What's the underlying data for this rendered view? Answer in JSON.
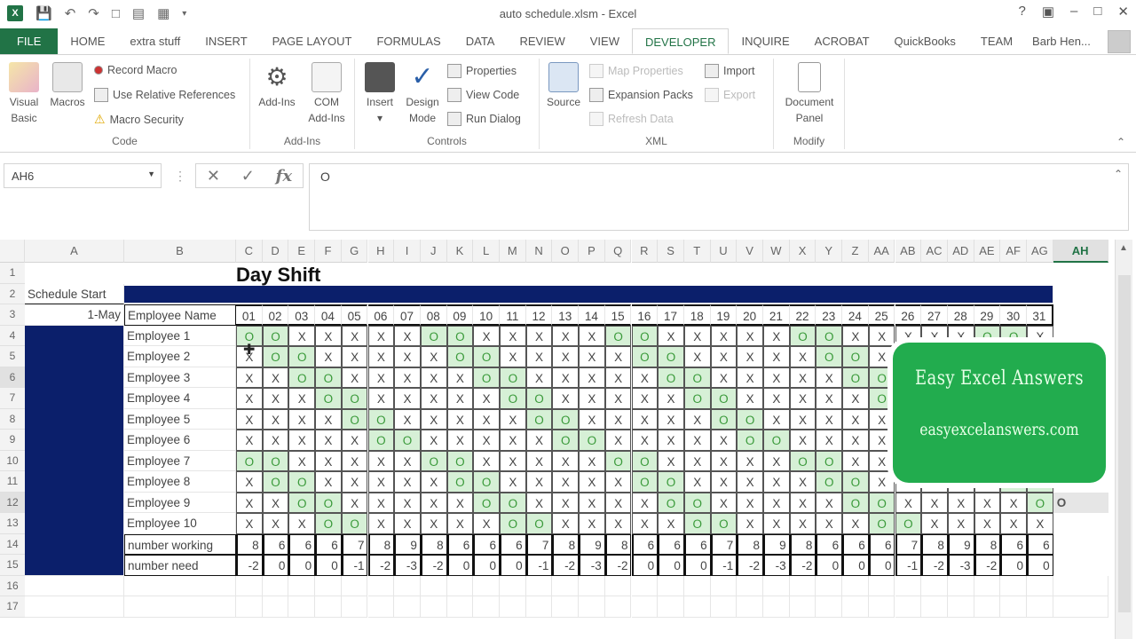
{
  "window": {
    "title": "auto schedule.xlsm - Excel",
    "controls": [
      "?",
      "▣",
      "–",
      "□",
      "✕"
    ]
  },
  "qat": {
    "icons": [
      "excel-logo-icon",
      "save-icon",
      "undo-icon",
      "redo-icon",
      "new-file-icon",
      "form-icon",
      "camera-icon",
      "customize-icon"
    ]
  },
  "tabs": [
    {
      "label": "FILE"
    },
    {
      "label": "HOME"
    },
    {
      "label": "extra stuff"
    },
    {
      "label": "INSERT"
    },
    {
      "label": "PAGE LAYOUT"
    },
    {
      "label": "FORMULAS"
    },
    {
      "label": "DATA"
    },
    {
      "label": "REVIEW"
    },
    {
      "label": "VIEW"
    },
    {
      "label": "DEVELOPER",
      "active": true
    },
    {
      "label": "INQUIRE"
    },
    {
      "label": "ACROBAT"
    },
    {
      "label": "QuickBooks"
    },
    {
      "label": "TEAM"
    }
  ],
  "user": {
    "name": "Barb Hen... ▾"
  },
  "ribbon": {
    "code": {
      "label": "Code",
      "visual_basic": "Visual Basic",
      "macros": "Macros",
      "record_macro": "Record Macro",
      "use_relative": "Use Relative References",
      "macro_security": "Macro Security"
    },
    "addins": {
      "label": "Add-Ins",
      "addins": "Add-Ins",
      "com_addins": "COM Add-Ins"
    },
    "controls": {
      "label": "Controls",
      "insert": "Insert",
      "design_mode": "Design Mode",
      "properties": "Properties",
      "view_code": "View Code",
      "run_dialog": "Run Dialog"
    },
    "xml": {
      "label": "XML",
      "source": "Source",
      "map_properties": "Map Properties",
      "expansion_packs": "Expansion Packs",
      "refresh_data": "Refresh Data",
      "import": "Import",
      "export": "Export"
    },
    "modify": {
      "label": "Modify",
      "document_panel": "Document Panel"
    }
  },
  "formula_bar": {
    "name_box": "AH6",
    "cancel": "✕",
    "enter": "✓",
    "fx": "fx",
    "value": "O"
  },
  "sheet": {
    "columns": [
      "A",
      "B",
      "C",
      "D",
      "E",
      "F",
      "G",
      "H",
      "I",
      "J",
      "K",
      "L",
      "M",
      "N",
      "O",
      "P",
      "Q",
      "R",
      "S",
      "T",
      "U",
      "V",
      "W",
      "X",
      "Y",
      "Z",
      "AA",
      "AB",
      "AC",
      "AD",
      "AE",
      "AF",
      "AG",
      "AH"
    ],
    "selected_column": "AH",
    "rows": [
      "1",
      "2",
      "3",
      "4",
      "5",
      "6",
      "7",
      "8",
      "9",
      "10",
      "11",
      "12",
      "13",
      "14",
      "15",
      "16",
      "17"
    ],
    "title": "Day Shift",
    "schedule_start_label": "Schedule Start",
    "schedule_start_value": "1-May",
    "employee_name_header": "Employee Name",
    "days": [
      "01",
      "02",
      "03",
      "04",
      "05",
      "06",
      "07",
      "08",
      "09",
      "10",
      "11",
      "12",
      "13",
      "14",
      "15",
      "16",
      "17",
      "18",
      "19",
      "20",
      "21",
      "22",
      "23",
      "24",
      "25",
      "26",
      "27",
      "28",
      "29",
      "30",
      "31"
    ],
    "employees": [
      {
        "name": "Employee 1",
        "shifts": "OOXXXXXOOXXXXXOOXXXXXOOXXXXXOOX"
      },
      {
        "name": "Employee 2",
        "shifts": "XOOXXXXXOOXXXXXOOXXXXXOOXXXXXOO"
      },
      {
        "name": "Employee 3",
        "shifts": "XXOOXXXXXOOXXXXXOOXXXXXOOXXXXXO"
      },
      {
        "name": "Employee 4",
        "shifts": "XXXOOXXXXXOOXXXXXOOXXXXXOOXXXXX"
      },
      {
        "name": "Employee 5",
        "shifts": "XXXXOOXXXXXOOXXXXXOOXXXXXOOXXXX"
      },
      {
        "name": "Employee 6",
        "shifts": "XXXXXOOXXXXXOOXXXXXOOXXXXXOOXXX"
      },
      {
        "name": "Employee 7",
        "shifts": "OOXXXXXOOXXXXXOOXXXXXOOXXXXXOOX"
      },
      {
        "name": "Employee 8",
        "shifts": "XOOXXXXXOOXXXXXOOXXXXXOOXXXXXOO"
      },
      {
        "name": "Employee 9",
        "shifts": "XXOOXXXXXOOXXXXXOOXXXXXOOXXXXXO"
      },
      {
        "name": "Employee 10",
        "shifts": "XXXOOXXXXXOOXXXXXOOXXXXXOOXXXXX"
      }
    ],
    "number_working_label": "number working",
    "number_working": [
      8,
      6,
      6,
      6,
      7,
      8,
      9,
      8,
      6,
      6,
      6,
      7,
      8,
      9,
      8,
      6,
      6,
      6,
      7,
      8,
      9,
      8,
      6,
      6,
      6,
      7,
      8,
      9,
      8,
      6,
      6
    ],
    "number_need_label": "number need",
    "number_need": [
      -2,
      0,
      0,
      0,
      -1,
      -2,
      -3,
      -2,
      0,
      0,
      0,
      -1,
      -2,
      -3,
      -2,
      0,
      0,
      0,
      -1,
      -2,
      -3,
      -2,
      0,
      0,
      0,
      -1,
      -2,
      -3,
      -2,
      0,
      0
    ],
    "ah12_value": "O"
  },
  "colors": {
    "navy": "#0b1f6b",
    "off_fill": "#d6f0d6",
    "off_text": "#3a9a3a",
    "excel_green": "#217346",
    "overlay_green": "#22ac4e"
  },
  "overlay": {
    "title": "Easy Excel Answers",
    "url": "easyexcelanswers.com"
  }
}
